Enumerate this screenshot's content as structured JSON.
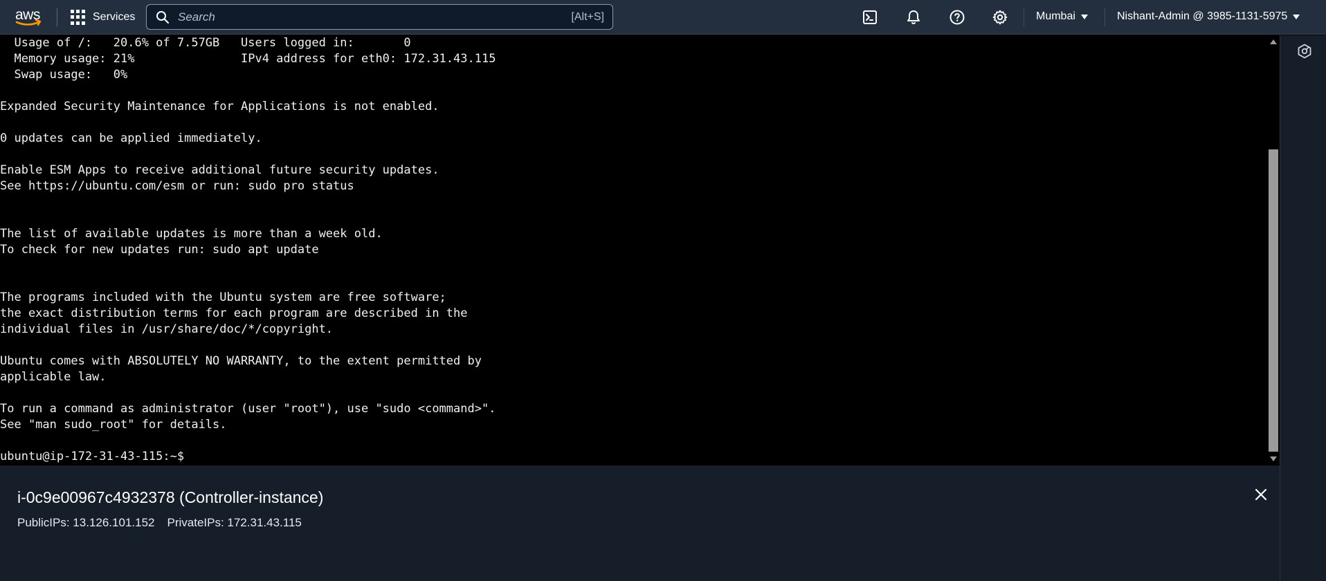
{
  "nav": {
    "logo_text": "aws",
    "services_label": "Services",
    "search_placeholder": "Search",
    "search_shortcut": "[Alt+S]",
    "region": "Mumbai",
    "account": "Nishant-Admin @ 3985-1131-5975",
    "icons": [
      "cloudshell-icon",
      "notifications-icon",
      "help-icon",
      "settings-icon"
    ]
  },
  "terminal": {
    "lines": [
      "  Usage of /:   20.6% of 7.57GB   Users logged in:       0",
      "  Memory usage: 21%               IPv4 address for eth0: 172.31.43.115",
      "  Swap usage:   0%",
      "",
      "Expanded Security Maintenance for Applications is not enabled.",
      "",
      "0 updates can be applied immediately.",
      "",
      "Enable ESM Apps to receive additional future security updates.",
      "See https://ubuntu.com/esm or run: sudo pro status",
      "",
      "",
      "The list of available updates is more than a week old.",
      "To check for new updates run: sudo apt update",
      "",
      "",
      "The programs included with the Ubuntu system are free software;",
      "the exact distribution terms for each program are described in the",
      "individual files in /usr/share/doc/*/copyright.",
      "",
      "Ubuntu comes with ABSOLUTELY NO WARRANTY, to the extent permitted by",
      "applicable law.",
      "",
      "To run a command as administrator (user \"root\"), use \"sudo <command>\".",
      "See \"man sudo_root\" for details.",
      "",
      "ubuntu@ip-172-31-43-115:~$"
    ]
  },
  "instance": {
    "title": "i-0c9e00967c4932378 (Controller-instance)",
    "public_ips": "PublicIPs: 13.126.101.152",
    "private_ips": "PrivateIPs: 172.31.43.115"
  },
  "colors": {
    "nav_bg": "#232f3e",
    "panel_bg": "#161e2a",
    "terminal_bg": "#000000",
    "terminal_fg": "#f0f0f0"
  }
}
